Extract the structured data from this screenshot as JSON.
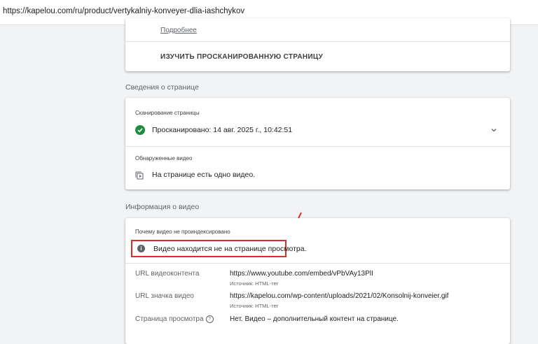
{
  "browser": {
    "url": "https://kapelou.com/ru/product/vertykalniy-konveyer-dlia-iashchykov"
  },
  "inspect_card": {
    "more_link": "Подробнее",
    "action_label": "ИЗУЧИТЬ ПРОСКАНИРОВАННУЮ СТРАНИЦУ"
  },
  "page_info": {
    "section_title": "Сведения о странице",
    "crawl_label": "Сканирование страницы",
    "crawl_status": "Просканировано: 14 авг. 2025 г., 10:42:51",
    "videos_label": "Обнаруженные видео",
    "videos_text": "На странице есть одно видео."
  },
  "video_info": {
    "section_title": "Информация о видео",
    "reason_label": "Почему видео не проиндексировано",
    "reason_text": "Видео находится не на странице просмотра.",
    "rows": [
      {
        "key": "URL видеоконтента",
        "value": "https://www.youtube.com/embed/vPbVAy13PlI",
        "source": "Источник: HTML-тег"
      },
      {
        "key": "URL значка видео",
        "value": "https://kapelou.com/wp-content/uploads/2021/02/Konsolnij-konveier.gif",
        "source": "Источник: HTML-тег"
      },
      {
        "key": "Страница просмотра",
        "value": "Нет. Видео – дополнительный контент на странице.",
        "help": "?"
      }
    ]
  },
  "colors": {
    "success": "#1e8e3e",
    "highlight": "#d93025"
  }
}
